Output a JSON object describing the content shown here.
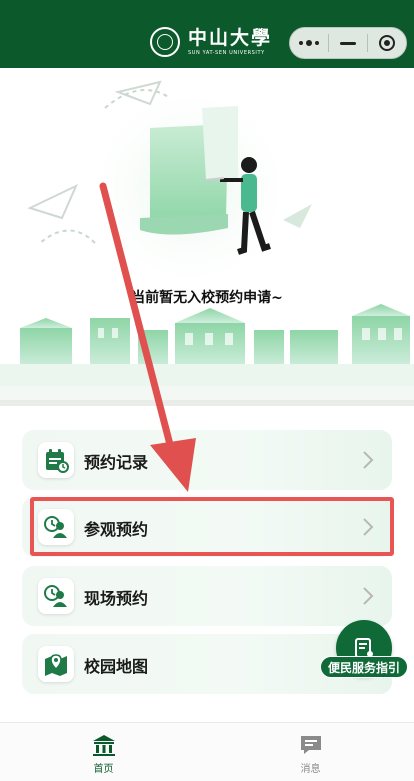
{
  "header": {
    "logo_cn": "中山大學",
    "logo_en": "SUN YAT-SEN UNIVERSITY",
    "capsule": {
      "more_icon": "more-dots-icon",
      "minimize_icon": "minus-icon",
      "close_icon": "target-close-icon"
    }
  },
  "hero": {
    "empty_message": "当前暂无入校预约申请~"
  },
  "menu": {
    "items": [
      {
        "label": "预约记录",
        "icon": "calendar-clock-icon"
      },
      {
        "label": "参观预约",
        "icon": "person-clock-icon"
      },
      {
        "label": "现场预约",
        "icon": "person-clock-icon"
      },
      {
        "label": "校园地图",
        "icon": "map-pin-icon"
      }
    ]
  },
  "fab": {
    "label": "便民服务指引",
    "icon": "guide-document-icon"
  },
  "tabbar": {
    "tabs": [
      {
        "label": "首页",
        "icon": "home-building-icon",
        "active": true
      },
      {
        "label": "消息",
        "icon": "message-icon",
        "active": false
      }
    ]
  },
  "colors": {
    "brand": "#0c5a2c",
    "accent_light": "#e8f5ec",
    "highlight": "#e85555"
  }
}
